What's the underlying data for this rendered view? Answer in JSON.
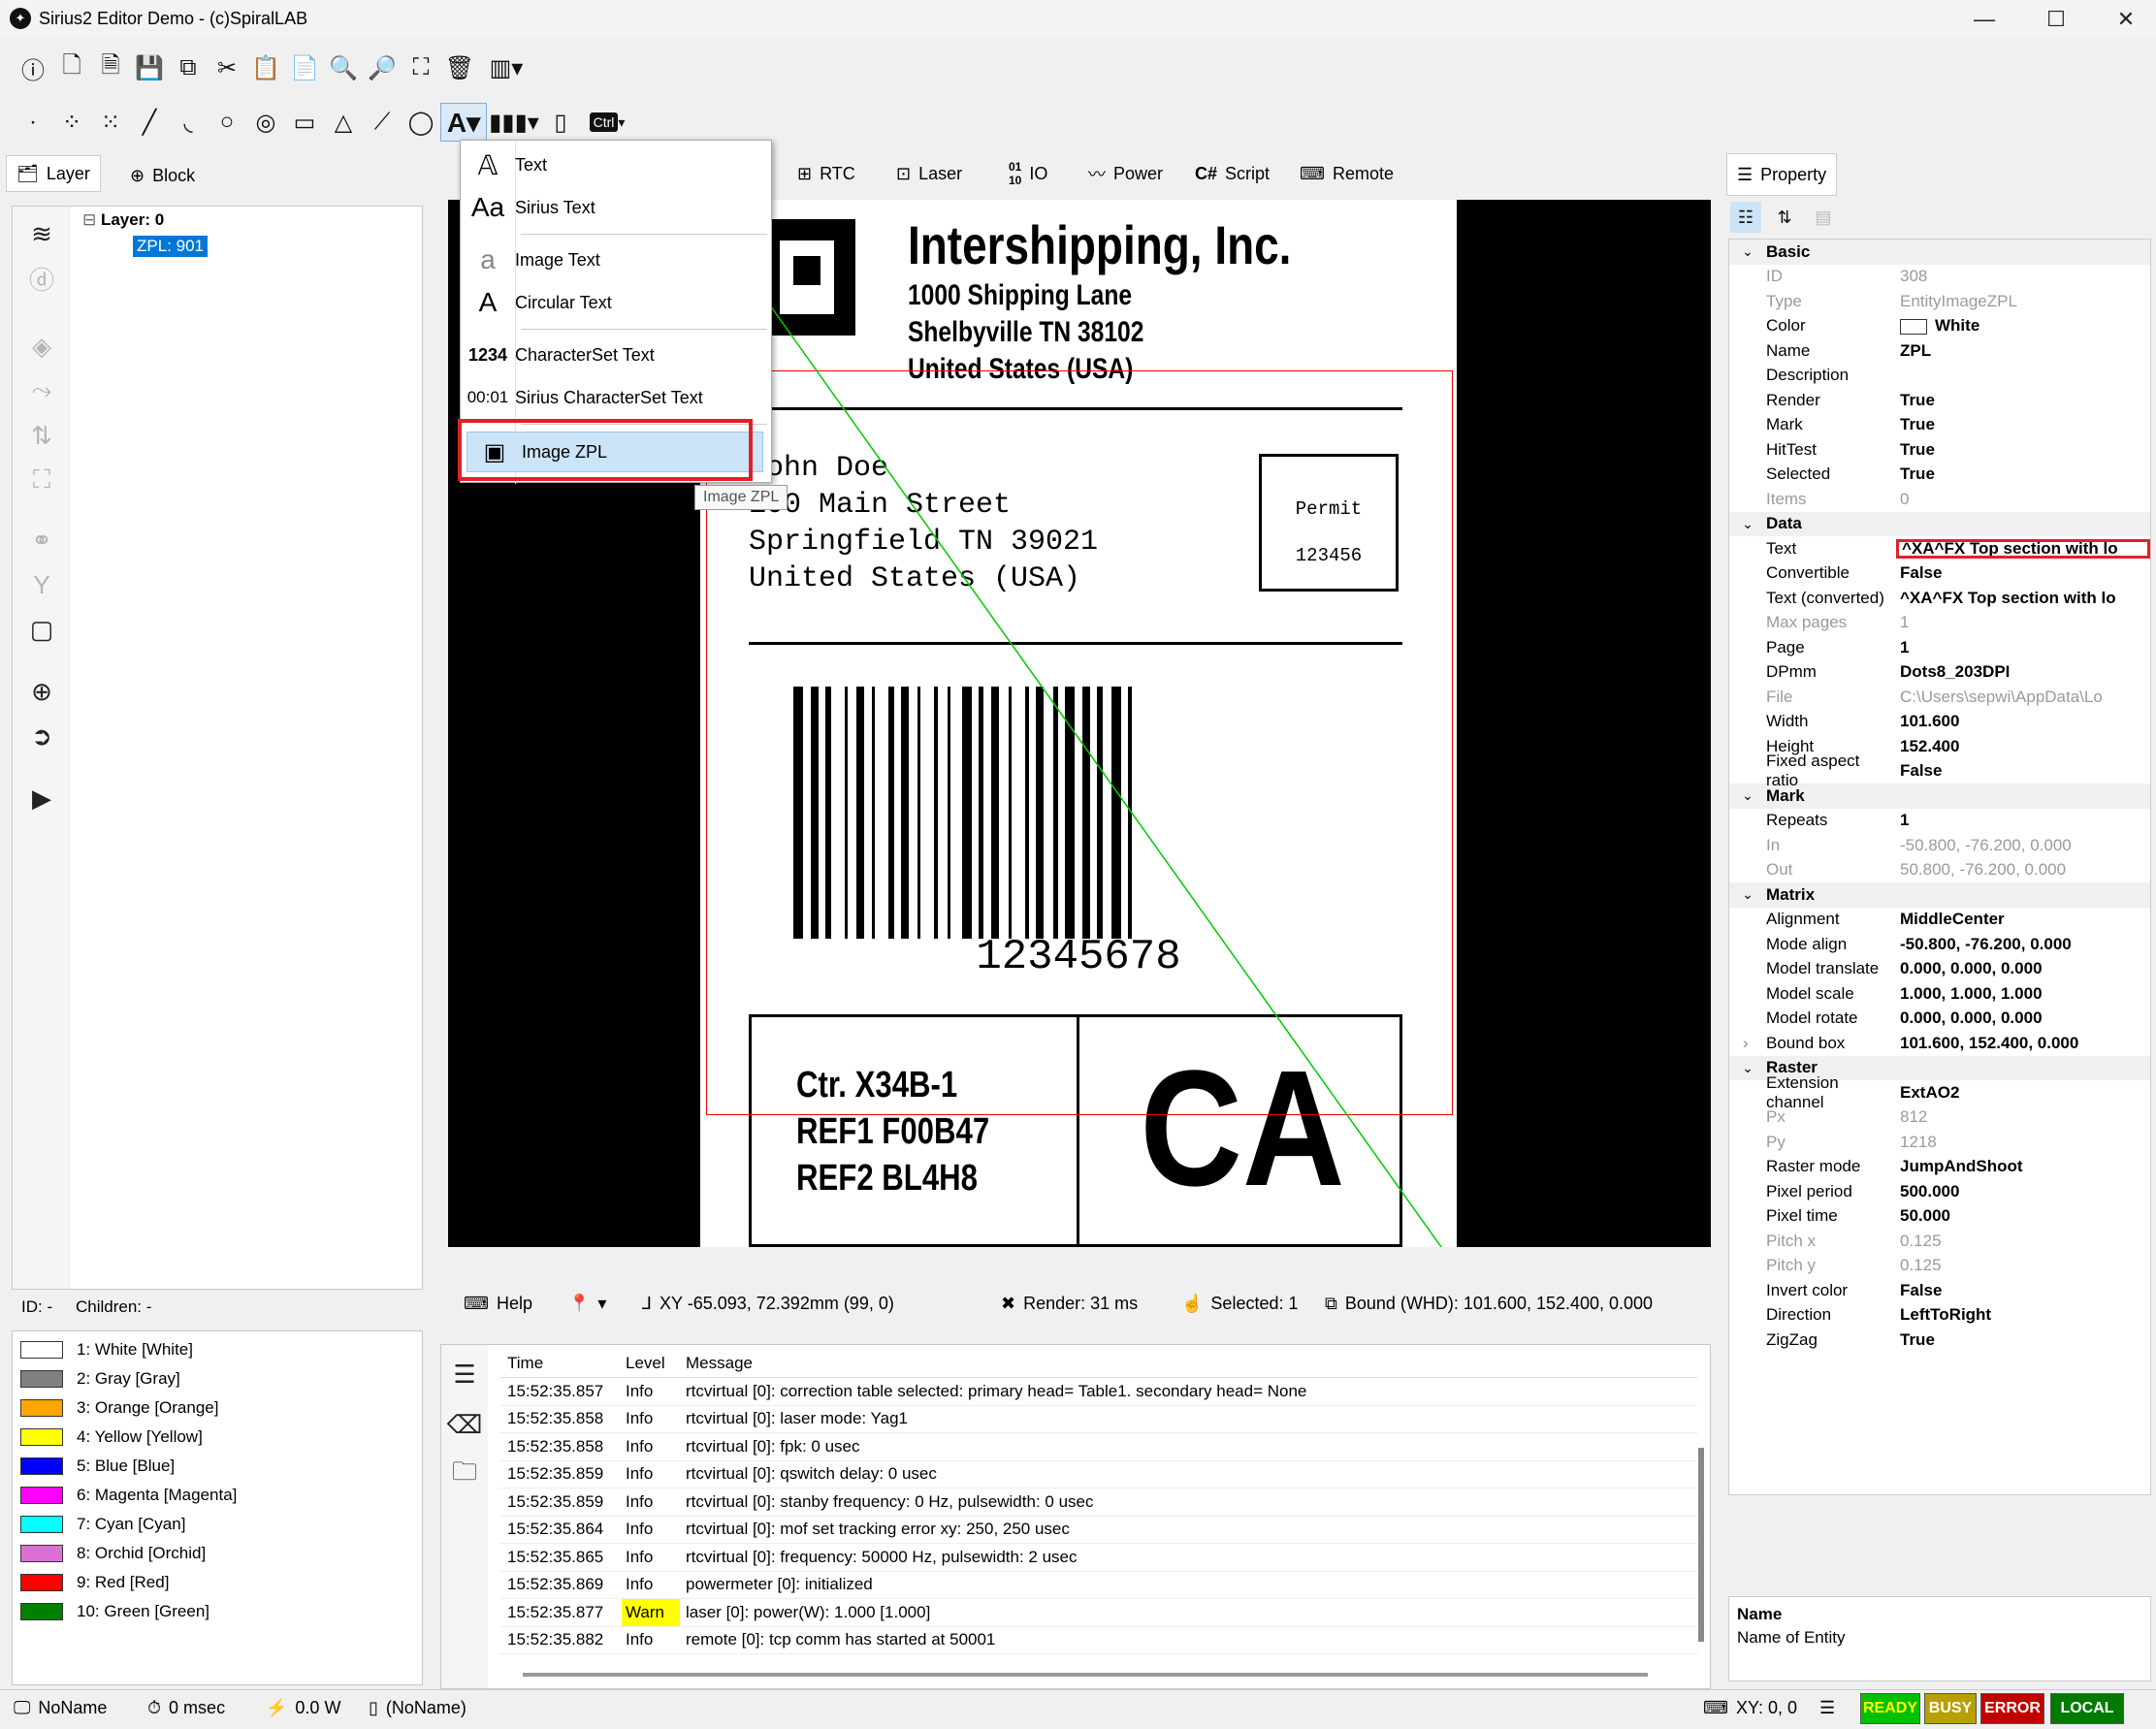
{
  "window": {
    "title": "Sirius2 Editor Demo - (c)SpiralLAB",
    "minimize": "—",
    "maximize": "☐",
    "close": "✕"
  },
  "left_tabs": {
    "layer": "Layer",
    "block": "Block"
  },
  "tree": {
    "root": "Layer: 0",
    "child": "ZPL: 901"
  },
  "tree_status": {
    "id": "ID: -",
    "children": "Children: -"
  },
  "pens": [
    {
      "label": "1: White [White]",
      "color": "#ffffff"
    },
    {
      "label": "2: Gray [Gray]",
      "color": "#808080"
    },
    {
      "label": "3: Orange [Orange]",
      "color": "#ffa500"
    },
    {
      "label": "4: Yellow [Yellow]",
      "color": "#ffff00"
    },
    {
      "label": "5: Blue [Blue]",
      "color": "#0000ff"
    },
    {
      "label": "6: Magenta [Magenta]",
      "color": "#ff00ff"
    },
    {
      "label": "7: Cyan [Cyan]",
      "color": "#00ffff"
    },
    {
      "label": "8: Orchid [Orchid]",
      "color": "#da70d6"
    },
    {
      "label": "9: Red [Red]",
      "color": "#ff0000"
    },
    {
      "label": "10: Green [Green]",
      "color": "#008000"
    }
  ],
  "center_tabs": {
    "rtc": "RTC",
    "laser": "Laser",
    "io": "IO",
    "power": "Power",
    "script": "Script",
    "remote": "Remote"
  },
  "text_menu": {
    "items": [
      "Text",
      "Sirius Text",
      "Image Text",
      "Circular Text",
      "CharacterSet Text",
      "Sirius CharacterSet Text",
      "Image ZPL"
    ],
    "tooltip": "Image ZPL"
  },
  "label": {
    "company": "Intershipping, Inc.",
    "addr1": "1000 Shipping Lane",
    "addr2": "Shelbyville TN 38102",
    "addr3": "United States (USA)",
    "to1": "John Doe",
    "to2": "100 Main Street",
    "to3": "Springfield TN 39021",
    "to4": "United States (USA)",
    "permit": "Permit",
    "permit_no": "123456",
    "barcode_text": "12345678",
    "ctr": "Ctr. X34B-1",
    "ref1": "REF1 F00B47",
    "ref2": "REF2 BL4H8",
    "state": "CA"
  },
  "canvas_status": {
    "help": "Help",
    "xy": "XY -65.093, 72.392mm (99, 0)",
    "render": "Render: 31 ms",
    "selected": "Selected: 1",
    "bound": "Bound (WHD): 101.600, 152.400, 0.000"
  },
  "log": {
    "headers": [
      "Time",
      "Level",
      "Message"
    ],
    "rows": [
      {
        "time": "15:52:35.857",
        "level": "Info",
        "msg": "rtcvirtual [0]: correction table selected: primary head= Table1. secondary head= None"
      },
      {
        "time": "15:52:35.858",
        "level": "Info",
        "msg": "rtcvirtual [0]: laser mode: Yag1"
      },
      {
        "time": "15:52:35.858",
        "level": "Info",
        "msg": "rtcvirtual [0]: fpk: 0 usec"
      },
      {
        "time": "15:52:35.859",
        "level": "Info",
        "msg": "rtcvirtual [0]: qswitch delay: 0 usec"
      },
      {
        "time": "15:52:35.859",
        "level": "Info",
        "msg": "rtcvirtual [0]: stanby frequency: 0 Hz, pulsewidth: 0 usec"
      },
      {
        "time": "15:52:35.864",
        "level": "Info",
        "msg": "rtcvirtual [0]: mof set tracking error xy: 250, 250 usec"
      },
      {
        "time": "15:52:35.865",
        "level": "Info",
        "msg": "rtcvirtual [0]: frequency: 50000 Hz, pulsewidth: 2 usec"
      },
      {
        "time": "15:52:35.869",
        "level": "Info",
        "msg": "powermeter [0]: initialized"
      },
      {
        "time": "15:52:35.877",
        "level": "Warn",
        "msg": "laser [0]: power(W): 1.000 [1.000]"
      },
      {
        "time": "15:52:35.882",
        "level": "Info",
        "msg": "remote [0]: tcp comm has started at 50001"
      }
    ]
  },
  "property": {
    "tab": "Property",
    "sections": [
      {
        "name": "Basic",
        "rows": [
          {
            "k": "ID",
            "v": "308",
            "dim": true
          },
          {
            "k": "Type",
            "v": "EntityImageZPL",
            "dim": true
          },
          {
            "k": "Color",
            "v": "White",
            "swatch": true
          },
          {
            "k": "Name",
            "v": "ZPL"
          },
          {
            "k": "Description",
            "v": ""
          },
          {
            "k": "Render",
            "v": "True"
          },
          {
            "k": "Mark",
            "v": "True"
          },
          {
            "k": "HitTest",
            "v": "True"
          },
          {
            "k": "Selected",
            "v": "True"
          },
          {
            "k": "Items",
            "v": "0",
            "dim": true
          }
        ]
      },
      {
        "name": "Data",
        "rows": [
          {
            "k": "Text",
            "v": "^XA^FX Top section with lo",
            "highlight": true
          },
          {
            "k": "Convertible",
            "v": "False"
          },
          {
            "k": "Text (converted)",
            "v": "^XA^FX Top section with lo"
          },
          {
            "k": "Max pages",
            "v": "1",
            "dim": true
          },
          {
            "k": "Page",
            "v": "1"
          },
          {
            "k": "DPmm",
            "v": "Dots8_203DPI"
          },
          {
            "k": "File",
            "v": "C:\\Users\\sepwi\\AppData\\Lo",
            "dim": true
          },
          {
            "k": "Width",
            "v": "101.600"
          },
          {
            "k": "Height",
            "v": "152.400"
          },
          {
            "k": "Fixed aspect ratio",
            "v": "False"
          }
        ]
      },
      {
        "name": "Mark",
        "rows": [
          {
            "k": "Repeats",
            "v": "1"
          },
          {
            "k": "In",
            "v": "-50.800, -76.200, 0.000",
            "dim": true
          },
          {
            "k": "Out",
            "v": "50.800, -76.200, 0.000",
            "dim": true
          }
        ]
      },
      {
        "name": "Matrix",
        "rows": [
          {
            "k": "Alignment",
            "v": "MiddleCenter"
          },
          {
            "k": "Mode align",
            "v": "-50.800, -76.200, 0.000"
          },
          {
            "k": "Model translate",
            "v": "0.000, 0.000, 0.000"
          },
          {
            "k": "Model scale",
            "v": "1.000, 1.000, 1.000"
          },
          {
            "k": "Model rotate",
            "v": "0.000, 0.000, 0.000"
          },
          {
            "k": "Bound box",
            "v": "101.600, 152.400, 0.000",
            "expand": true
          }
        ]
      },
      {
        "name": "Raster",
        "rows": [
          {
            "k": "Extension channel",
            "v": "ExtAO2"
          },
          {
            "k": "Px",
            "v": "812",
            "dim": true
          },
          {
            "k": "Py",
            "v": "1218",
            "dim": true
          },
          {
            "k": "Raster mode",
            "v": "JumpAndShoot"
          },
          {
            "k": "Pixel period",
            "v": "500.000"
          },
          {
            "k": "Pixel time",
            "v": "50.000"
          },
          {
            "k": "Pitch x",
            "v": "0.125",
            "dim": true
          },
          {
            "k": "Pitch y",
            "v": "0.125",
            "dim": true
          },
          {
            "k": "Invert color",
            "v": "False"
          },
          {
            "k": "Direction",
            "v": "LeftToRight"
          },
          {
            "k": "ZigZag",
            "v": "True"
          }
        ]
      }
    ],
    "desc_title": "Name",
    "desc_text": "Name of Entity"
  },
  "statusbar": {
    "name": "NoName",
    "time": "0 msec",
    "power": "0.0 W",
    "file": "(NoName)",
    "xy": "XY: 0, 0",
    "ready": "READY",
    "busy": "BUSY",
    "error": "ERROR",
    "local": "LOCAL"
  },
  "colors": {
    "selection": "#0078d7",
    "menu_highlight": "#cce4f7",
    "warn": "#ffff00",
    "ready": "#00c000",
    "busy": "#b8a000",
    "error": "#c00000",
    "local": "#007a00"
  }
}
